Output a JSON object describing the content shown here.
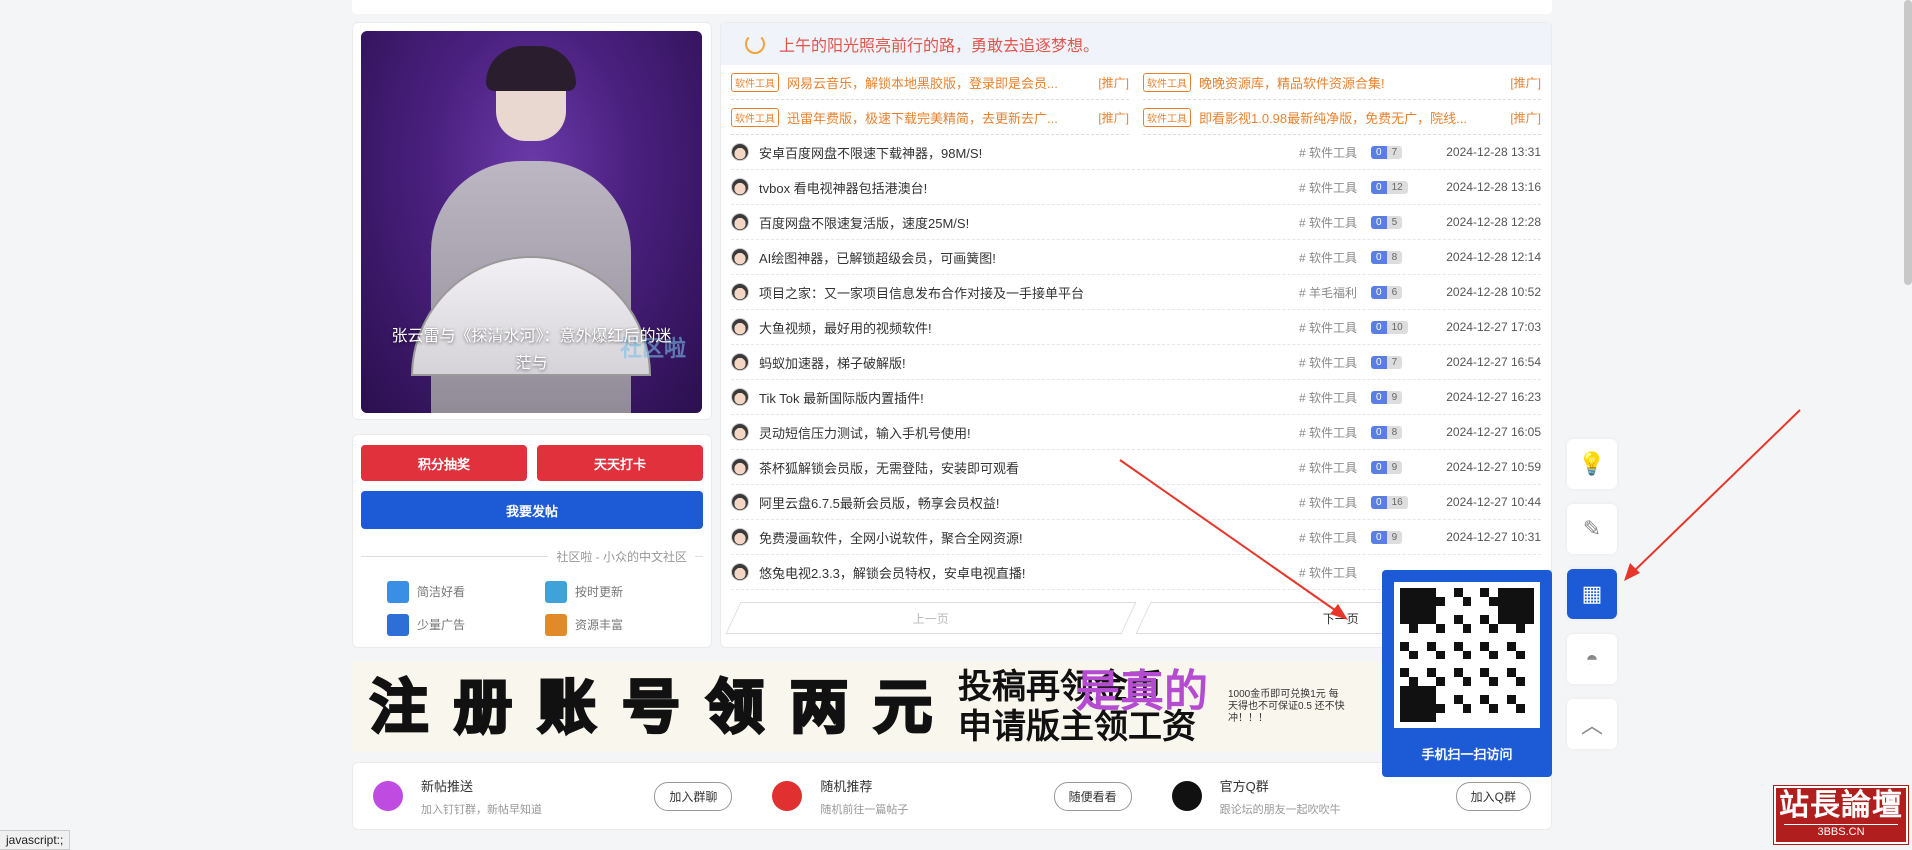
{
  "slider": {
    "caption": "张云雷与《探清水河》：意外爆红后的迷茫与",
    "dots": 10,
    "active": 5,
    "watermark": "社区啦"
  },
  "actions": {
    "lottery": "积分抽奖",
    "checkin": "天天打卡",
    "post": "我要发帖"
  },
  "motto": "社区啦 - 小众的中文社区",
  "features": [
    {
      "label": "简洁好看",
      "color": "#3a8ee6"
    },
    {
      "label": "按时更新",
      "color": "#3fa2d9"
    },
    {
      "label": "少量广告",
      "color": "#2d6fd6"
    },
    {
      "label": "资源丰富",
      "color": "#e08a2a"
    }
  ],
  "greeting": "上午的阳光照亮前行的路，勇敢去追逐梦想。",
  "promos": [
    {
      "tag": "软件工具",
      "title": "网易云音乐，解锁本地黑胶版，登录即是会员...",
      "ad": "[推广]"
    },
    {
      "tag": "软件工具",
      "title": "晚晚资源库，精品软件资源合集!",
      "ad": "[推广]"
    },
    {
      "tag": "软件工具",
      "title": "迅雷年费版，极速下载完美精简，去更新去广...",
      "ad": "[推广]"
    },
    {
      "tag": "软件工具",
      "title": "即看影视1.0.98最新纯净版，免费无广，院线...",
      "ad": "[推广]"
    }
  ],
  "posts": [
    {
      "title": "安卓百度网盘不限速下载神器，98M/S!",
      "cat": "# 软件工具",
      "n": "0",
      "c": "7",
      "date": "2024-12-28 13:31"
    },
    {
      "title": "tvbox 看电视神器包括港澳台!",
      "cat": "# 软件工具",
      "n": "0",
      "c": "12",
      "date": "2024-12-28 13:16"
    },
    {
      "title": "百度网盘不限速复活版，速度25M/S!",
      "cat": "# 软件工具",
      "n": "0",
      "c": "5",
      "date": "2024-12-28 12:28"
    },
    {
      "title": "AI绘图神器，已解锁超级会员，可画簧图!",
      "cat": "# 软件工具",
      "n": "0",
      "c": "8",
      "date": "2024-12-28 12:14"
    },
    {
      "title": "项目之家：又一家项目信息发布合作对接及一手接单平台",
      "cat": "# 羊毛福利",
      "n": "0",
      "c": "6",
      "date": "2024-12-28 10:52"
    },
    {
      "title": "大鱼视频，最好用的视频软件!",
      "cat": "# 软件工具",
      "n": "0",
      "c": "10",
      "date": "2024-12-27 17:03"
    },
    {
      "title": "蚂蚁加速器，梯子破解版!",
      "cat": "# 软件工具",
      "n": "0",
      "c": "7",
      "date": "2024-12-27 16:54"
    },
    {
      "title": "Tik Tok 最新国际版内置插件!",
      "cat": "# 软件工具",
      "n": "0",
      "c": "9",
      "date": "2024-12-27 16:23"
    },
    {
      "title": "灵动短信压力测试，输入手机号使用!",
      "cat": "# 软件工具",
      "n": "0",
      "c": "8",
      "date": "2024-12-27 16:05"
    },
    {
      "title": "茶杯狐解锁会员版，无需登陆，安装即可观看",
      "cat": "# 软件工具",
      "n": "0",
      "c": "9",
      "date": "2024-12-27 10:59"
    },
    {
      "title": "阿里云盘6.7.5最新会员版，畅享会员权益!",
      "cat": "# 软件工具",
      "n": "0",
      "c": "16",
      "date": "2024-12-27 10:44"
    },
    {
      "title": "免费漫画软件，全网小说软件，聚合全网资源!",
      "cat": "# 软件工具",
      "n": "0",
      "c": "9",
      "date": "2024-12-27 10:31"
    },
    {
      "title": "悠兔电视2.3.3，解锁会员特权，安卓电视直播!",
      "cat": "# 软件工具",
      "n": "",
      "c": "",
      "date": ""
    }
  ],
  "pager": {
    "prev": "上一页",
    "next": "下一页"
  },
  "banner": {
    "chars": [
      "注",
      "册",
      "账",
      "号",
      "领",
      "两",
      "元"
    ],
    "colors": [
      "#f08a18",
      "#1fa05a",
      "#8a3fc6",
      "#2e4fc6",
      "#8a3fc6",
      "#e03030",
      "#1fa05a"
    ],
    "line1": "投稿再领金币",
    "line2": "申请版主领工资",
    "small": "1000金币即可兑换1元 每天得也不可保证0.5 还不快冲！！！",
    "pink": "是真的"
  },
  "bottom": [
    {
      "title": "新帖推送",
      "sub": "加入钉钉群，新帖早知道",
      "btn": "加入群聊"
    },
    {
      "title": "随机推荐",
      "sub": "随机前往一篇帖子",
      "btn": "随便看看"
    },
    {
      "title": "官方Q群",
      "sub": "跟论坛的朋友一起吹吹牛",
      "btn": "加入Q群"
    }
  ],
  "qr": {
    "caption": "手机扫一扫访问"
  },
  "status": "javascript:;",
  "logo": {
    "main": "站長論壇",
    "sub": "3BBS.CN"
  },
  "colors": {
    "accent": "#1d5ad6",
    "red": "#e0313d",
    "orange": "#e9822f"
  }
}
